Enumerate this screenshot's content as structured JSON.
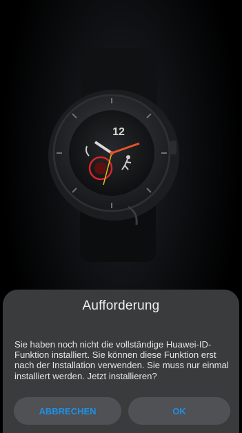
{
  "dialog": {
    "title": "Aufforderung",
    "message": "Sie haben noch nicht die vollständige Huawei-ID-Funktion installiert. Sie können diese Funktion erst nach der Installation verwenden. Sie muss nur einmal installiert werden. Jetzt installieren?",
    "cancel_label": "ABBRECHEN",
    "ok_label": "OK",
    "accent_color": "#1e90e6"
  },
  "watch": {
    "hour_numeral": "12",
    "image_description_icon": "smartwatch-image"
  }
}
